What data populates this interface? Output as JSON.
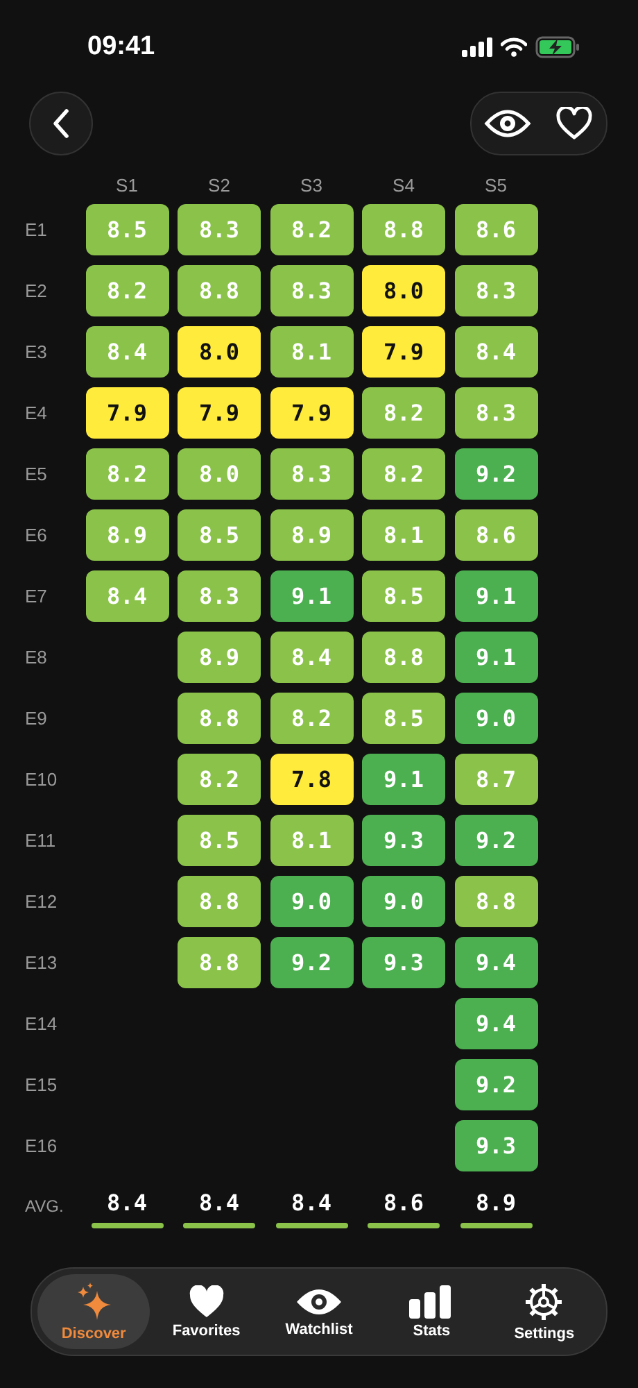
{
  "status_bar": {
    "time": "09:41"
  },
  "seasons": [
    "S1",
    "S2",
    "S3",
    "S4",
    "S5"
  ],
  "episodes": [
    {
      "label": "E1",
      "cells": [
        {
          "score": "8.5",
          "color": "#8bc34a"
        },
        {
          "score": "8.3",
          "color": "#8bc34a"
        },
        {
          "score": "8.2",
          "color": "#8bc34a"
        },
        {
          "score": "8.8",
          "color": "#8bc34a"
        },
        {
          "score": "8.6",
          "color": "#8bc34a"
        }
      ]
    },
    {
      "label": "E2",
      "cells": [
        {
          "score": "8.2",
          "color": "#8bc34a"
        },
        {
          "score": "8.8",
          "color": "#8bc34a"
        },
        {
          "score": "8.3",
          "color": "#8bc34a"
        },
        {
          "score": "8.0",
          "color": "#ffeb3b"
        },
        {
          "score": "8.3",
          "color": "#8bc34a"
        }
      ]
    },
    {
      "label": "E3",
      "cells": [
        {
          "score": "8.4",
          "color": "#8bc34a"
        },
        {
          "score": "8.0",
          "color": "#ffeb3b"
        },
        {
          "score": "8.1",
          "color": "#8bc34a"
        },
        {
          "score": "7.9",
          "color": "#ffeb3b"
        },
        {
          "score": "8.4",
          "color": "#8bc34a"
        }
      ]
    },
    {
      "label": "E4",
      "cells": [
        {
          "score": "7.9",
          "color": "#ffeb3b"
        },
        {
          "score": "7.9",
          "color": "#ffeb3b"
        },
        {
          "score": "7.9",
          "color": "#ffeb3b"
        },
        {
          "score": "8.2",
          "color": "#8bc34a"
        },
        {
          "score": "8.3",
          "color": "#8bc34a"
        }
      ]
    },
    {
      "label": "E5",
      "cells": [
        {
          "score": "8.2",
          "color": "#8bc34a"
        },
        {
          "score": "8.0",
          "color": "#8bc34a"
        },
        {
          "score": "8.3",
          "color": "#8bc34a"
        },
        {
          "score": "8.2",
          "color": "#8bc34a"
        },
        {
          "score": "9.2",
          "color": "#4caf50"
        }
      ]
    },
    {
      "label": "E6",
      "cells": [
        {
          "score": "8.9",
          "color": "#8bc34a"
        },
        {
          "score": "8.5",
          "color": "#8bc34a"
        },
        {
          "score": "8.9",
          "color": "#8bc34a"
        },
        {
          "score": "8.1",
          "color": "#8bc34a"
        },
        {
          "score": "8.6",
          "color": "#8bc34a"
        }
      ]
    },
    {
      "label": "E7",
      "cells": [
        {
          "score": "8.4",
          "color": "#8bc34a"
        },
        {
          "score": "8.3",
          "color": "#8bc34a"
        },
        {
          "score": "9.1",
          "color": "#4caf50"
        },
        {
          "score": "8.5",
          "color": "#8bc34a"
        },
        {
          "score": "9.1",
          "color": "#4caf50"
        }
      ]
    },
    {
      "label": "E8",
      "cells": [
        null,
        {
          "score": "8.9",
          "color": "#8bc34a"
        },
        {
          "score": "8.4",
          "color": "#8bc34a"
        },
        {
          "score": "8.8",
          "color": "#8bc34a"
        },
        {
          "score": "9.1",
          "color": "#4caf50"
        }
      ]
    },
    {
      "label": "E9",
      "cells": [
        null,
        {
          "score": "8.8",
          "color": "#8bc34a"
        },
        {
          "score": "8.2",
          "color": "#8bc34a"
        },
        {
          "score": "8.5",
          "color": "#8bc34a"
        },
        {
          "score": "9.0",
          "color": "#4caf50"
        }
      ]
    },
    {
      "label": "E10",
      "cells": [
        null,
        {
          "score": "8.2",
          "color": "#8bc34a"
        },
        {
          "score": "7.8",
          "color": "#ffeb3b"
        },
        {
          "score": "9.1",
          "color": "#4caf50"
        },
        {
          "score": "8.7",
          "color": "#8bc34a"
        }
      ]
    },
    {
      "label": "E11",
      "cells": [
        null,
        {
          "score": "8.5",
          "color": "#8bc34a"
        },
        {
          "score": "8.1",
          "color": "#8bc34a"
        },
        {
          "score": "9.3",
          "color": "#4caf50"
        },
        {
          "score": "9.2",
          "color": "#4caf50"
        }
      ]
    },
    {
      "label": "E12",
      "cells": [
        null,
        {
          "score": "8.8",
          "color": "#8bc34a"
        },
        {
          "score": "9.0",
          "color": "#4caf50"
        },
        {
          "score": "9.0",
          "color": "#4caf50"
        },
        {
          "score": "8.8",
          "color": "#8bc34a"
        }
      ]
    },
    {
      "label": "E13",
      "cells": [
        null,
        {
          "score": "8.8",
          "color": "#8bc34a"
        },
        {
          "score": "9.2",
          "color": "#4caf50"
        },
        {
          "score": "9.3",
          "color": "#4caf50"
        },
        {
          "score": "9.4",
          "color": "#4caf50"
        }
      ]
    },
    {
      "label": "E14",
      "cells": [
        null,
        null,
        null,
        null,
        {
          "score": "9.4",
          "color": "#4caf50"
        }
      ]
    },
    {
      "label": "E15",
      "cells": [
        null,
        null,
        null,
        null,
        {
          "score": "9.2",
          "color": "#4caf50"
        }
      ]
    },
    {
      "label": "E16",
      "cells": [
        null,
        null,
        null,
        null,
        {
          "score": "9.3",
          "color": "#4caf50"
        }
      ]
    }
  ],
  "averages": {
    "label": "AVG.",
    "values": [
      {
        "score": "8.4",
        "color": "#8bc34a"
      },
      {
        "score": "8.4",
        "color": "#8bc34a"
      },
      {
        "score": "8.4",
        "color": "#8bc34a"
      },
      {
        "score": "8.6",
        "color": "#8bc34a"
      },
      {
        "score": "8.9",
        "color": "#8bc34a"
      }
    ]
  },
  "tab_bar": [
    {
      "label": "Discover",
      "selected": true
    },
    {
      "label": "Favorites",
      "selected": false
    },
    {
      "label": "Watchlist",
      "selected": false
    },
    {
      "label": "Stats",
      "selected": false
    },
    {
      "label": "Settings",
      "selected": false
    }
  ]
}
